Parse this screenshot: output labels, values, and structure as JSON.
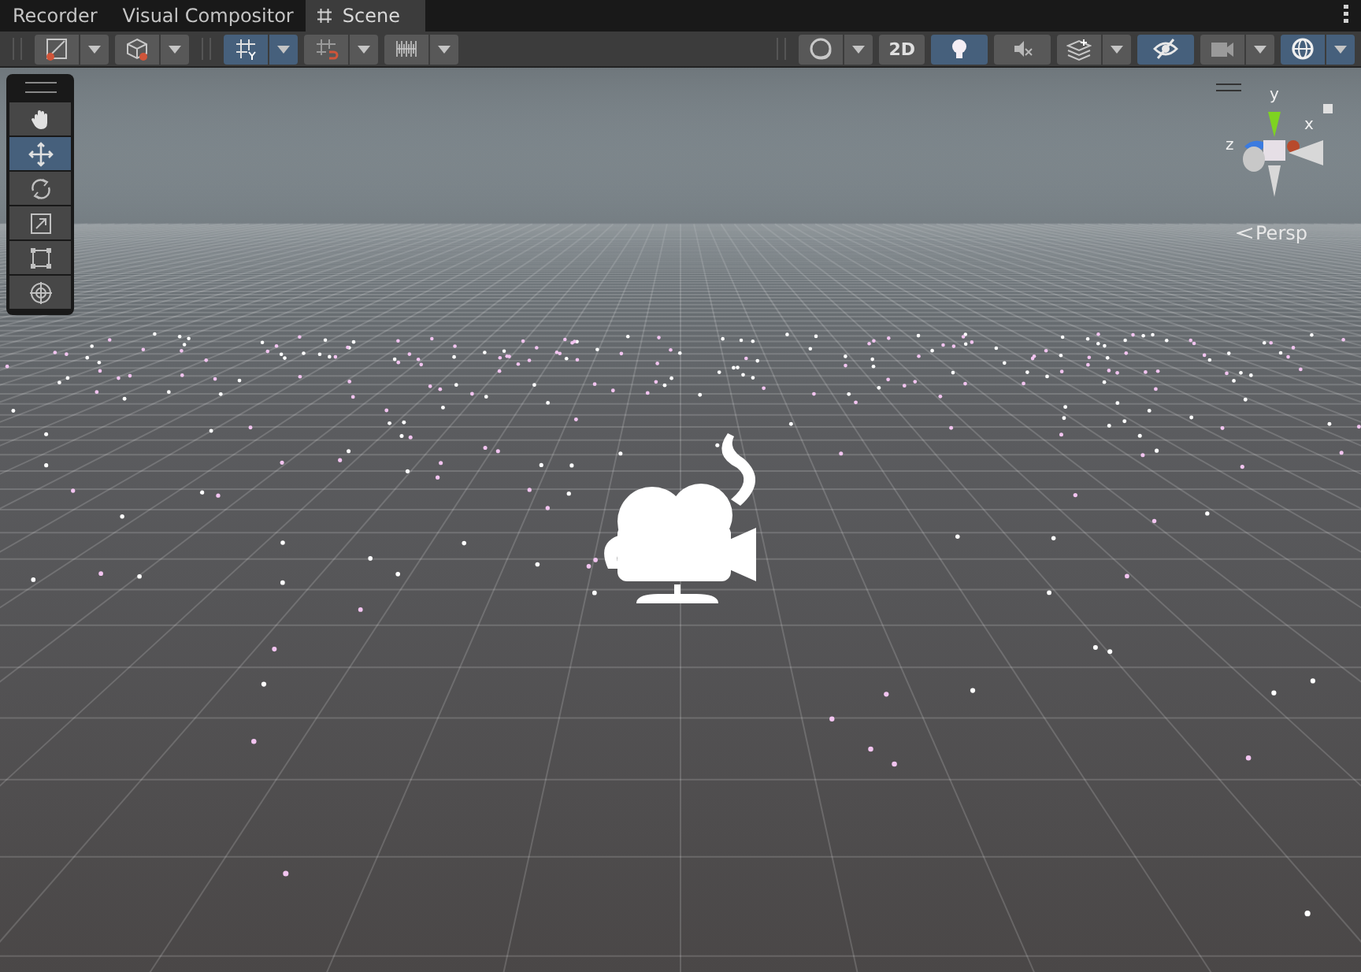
{
  "tabs": [
    {
      "label": "Recorder",
      "kind": "panel",
      "selected": false
    },
    {
      "label": "Visual Compositor",
      "kind": "panel",
      "selected": false
    },
    {
      "label": "Scene",
      "kind": "scene",
      "selected": true
    }
  ],
  "toolbar": {
    "left": [
      {
        "kind": "split",
        "on": false
      },
      {
        "kind": "split",
        "on": false
      },
      {
        "kind": "split",
        "on": true
      },
      {
        "kind": "split",
        "on": false
      },
      {
        "kind": "split",
        "on": false
      }
    ],
    "right": [
      {
        "kind": "split",
        "on": false
      },
      {
        "kind": "text",
        "label": "2D",
        "on": false
      },
      {
        "kind": "toggle",
        "on": true
      },
      {
        "kind": "toggle",
        "on": false
      },
      {
        "kind": "split",
        "on": false
      },
      {
        "kind": "toggle",
        "on": true
      },
      {
        "kind": "split",
        "on": false
      },
      {
        "kind": "split",
        "on": true
      }
    ]
  },
  "tools": [
    {
      "selected": false
    },
    {
      "selected": true
    },
    {
      "selected": false
    },
    {
      "selected": false
    },
    {
      "selected": false
    },
    {
      "selected": false
    }
  ],
  "gizmo": {
    "axes": [
      {
        "label": "y"
      },
      {
        "label": "z"
      },
      {
        "label": "x"
      }
    ],
    "projection": "Persp"
  }
}
